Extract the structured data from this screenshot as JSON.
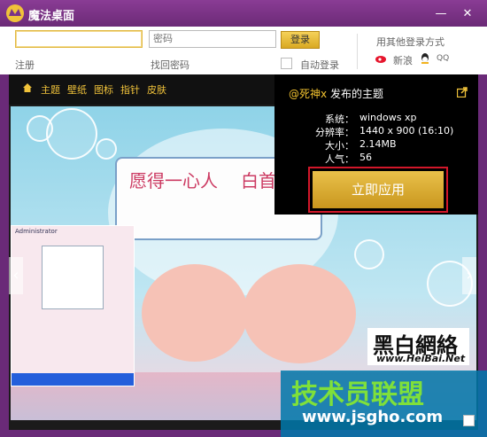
{
  "window": {
    "title": "魔法桌面"
  },
  "window_controls": {
    "minimize": "—",
    "close": "✕"
  },
  "login": {
    "username_value": "",
    "password_placeholder": "密码",
    "login_label": "登录",
    "register_label": "注册",
    "forgot_label": "找回密码",
    "auto_login_label": "自动登录",
    "other_methods_label": "用其他登录方式",
    "weibo_label": "新浪",
    "qq_label": "QQ"
  },
  "nav": {
    "items": [
      "主题",
      "壁纸",
      "图标",
      "指针",
      "皮肤"
    ]
  },
  "theme": {
    "author": "@死神x",
    "author_suffix": "发布的主题",
    "system_label": "系统：",
    "system_value": "windows xp",
    "resolution_label": "分辨率：",
    "resolution_value": "1440 x 900 (16:10)",
    "size_label": "大小：",
    "size_value": "2.14MB",
    "popularity_label": "人气：",
    "popularity_value": "56",
    "apply_label": "立即应用"
  },
  "wallpaper": {
    "text_left": "愿得一心人",
    "text_right": "白首不相"
  },
  "thumbnail": {
    "title": "Administrator"
  },
  "watermark": {
    "site1": "黑白網絡",
    "site1_url": "www.HeiBai.Net",
    "site2": "技术员联盟",
    "site2_url": "www.jsgho.com"
  },
  "colors": {
    "accent": "#f0c23a",
    "title_bg": "#7a3287",
    "apply_border": "#d2172a"
  }
}
